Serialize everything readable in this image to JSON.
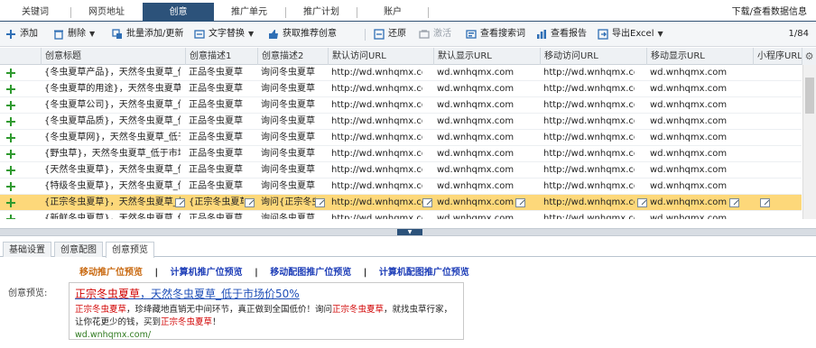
{
  "tabs": [
    {
      "label": "关键词",
      "active": false
    },
    {
      "label": "网页地址",
      "active": false
    },
    {
      "label": "创意",
      "active": true
    },
    {
      "label": "推广单元",
      "active": false
    },
    {
      "label": "推广计划",
      "active": false
    },
    {
      "label": "账户",
      "active": false
    }
  ],
  "tab_right": "下载/查看数据信息",
  "toolbar": {
    "add": "添加",
    "delete": "删除",
    "batch": "批量添加/更新",
    "replace": "文字替换",
    "recommend": "获取推荐创意",
    "restore": "还原",
    "activate": "激活",
    "view_keywords": "查看搜索词",
    "view_report": "查看报告",
    "export": "导出Excel",
    "pager": "1/84"
  },
  "grid": {
    "headers": [
      "创意标题",
      "创意描述1",
      "创意描述2",
      "默认访问URL",
      "默认显示URL",
      "移动访问URL",
      "移动显示URL",
      "小程序URL"
    ],
    "rows": [
      {
        "title": "{冬虫夏草产品}，天然冬虫夏草_低...",
        "d1": "正品冬虫夏草，...",
        "d2": "询问冬虫夏草...",
        "u1": "http://wd.wnhqmx.com/",
        "u2": "wd.wnhqmx.com/",
        "u3": "http://wd.wnhqmx.com/",
        "u4": "wd.wnhqmx.com/",
        "u5": "",
        "selected": false
      },
      {
        "title": "{冬虫夏草的用途}，天然冬虫夏草_低...",
        "d1": "正品冬虫夏草，...",
        "d2": "询问冬虫夏草...",
        "u1": "http://wd.wnhqmx.com/",
        "u2": "wd.wnhqmx.com/",
        "u3": "http://wd.wnhqmx.com/",
        "u4": "wd.wnhqmx.com/",
        "u5": "",
        "selected": false
      },
      {
        "title": "{冬虫夏草公司}，天然冬虫夏草_低...",
        "d1": "正品冬虫夏草，...",
        "d2": "询问冬虫夏草...",
        "u1": "http://wd.wnhqmx.com/",
        "u2": "wd.wnhqmx.com/",
        "u3": "http://wd.wnhqmx.com/",
        "u4": "wd.wnhqmx.com/",
        "u5": "",
        "selected": false
      },
      {
        "title": "{冬虫夏草品质}，天然冬虫夏草_低...",
        "d1": "正品冬虫夏草，...",
        "d2": "询问冬虫夏草...",
        "u1": "http://wd.wnhqmx.com/",
        "u2": "wd.wnhqmx.com/",
        "u3": "http://wd.wnhqmx.com/",
        "u4": "wd.wnhqmx.com/",
        "u5": "",
        "selected": false
      },
      {
        "title": "{冬虫夏草网}，天然冬虫夏草_低于...",
        "d1": "正品冬虫夏草，...",
        "d2": "询问冬虫夏草...",
        "u1": "http://wd.wnhqmx.com/",
        "u2": "wd.wnhqmx.com/",
        "u3": "http://wd.wnhqmx.com/",
        "u4": "wd.wnhqmx.com/",
        "u5": "",
        "selected": false
      },
      {
        "title": "{野虫草}，天然冬虫夏草_低于市场...",
        "d1": "正品冬虫夏草，...",
        "d2": "询问冬虫夏草...",
        "u1": "http://wd.wnhqmx.com/",
        "u2": "wd.wnhqmx.com/",
        "u3": "http://wd.wnhqmx.com/",
        "u4": "wd.wnhqmx.com/",
        "u5": "",
        "selected": false
      },
      {
        "title": "{天然冬虫夏草}，天然冬虫夏草_低...",
        "d1": "正品冬虫夏草，...",
        "d2": "询问冬虫夏草...",
        "u1": "http://wd.wnhqmx.com/",
        "u2": "wd.wnhqmx.com/",
        "u3": "http://wd.wnhqmx.com/",
        "u4": "wd.wnhqmx.com/",
        "u5": "",
        "selected": false
      },
      {
        "title": "{特级冬虫夏草}，天然冬虫夏草_低...",
        "d1": "正品冬虫夏草，...",
        "d2": "询问冬虫夏草...",
        "u1": "http://wd.wnhqmx.com/",
        "u2": "wd.wnhqmx.com/",
        "u3": "http://wd.wnhqmx.com/",
        "u4": "wd.wnhqmx.com/",
        "u5": "",
        "selected": false
      },
      {
        "title": "{正宗冬虫夏草}，天然冬虫夏草_低...",
        "d1": "{正宗冬虫夏草...",
        "d2": "询问{正宗冬虫...",
        "u1": "http://wd.wnhqmx.com/",
        "u2": "wd.wnhqmx.com/",
        "u3": "http://wd.wnhqmx.com/",
        "u4": "wd.wnhqmx.com/",
        "u5": "",
        "selected": true
      },
      {
        "title": "{新鲜冬虫夏草}，天然冬虫夏草_低...",
        "d1": "正品冬虫夏草，...",
        "d2": "询问冬虫夏草...",
        "u1": "http://wd.wnhqmx.com/",
        "u2": "wd.wnhqmx.com/",
        "u3": "http://wd.wnhqmx.com/",
        "u4": "wd.wnhqmx.com/",
        "u5": "",
        "selected": false
      }
    ]
  },
  "bottom_tabs": [
    {
      "label": "基础设置",
      "active": false
    },
    {
      "label": "创意配图",
      "active": false
    },
    {
      "label": "创意预览",
      "active": true
    }
  ],
  "preview": {
    "links": [
      "移动推广位预览",
      "计算机推广位预览",
      "移动配图推广位预览",
      "计算机配图推广位预览"
    ],
    "sep": "|",
    "label": "创意预览:",
    "title_red": "正宗冬虫夏草",
    "title_rest": "，天然冬虫夏草_低于市场价50%",
    "desc_1_red": "正宗冬虫夏草",
    "desc_1": "，珍绛藏地直销无中间环节，真正做到全国低价！询问",
    "desc_2_red": "正宗冬虫夏草",
    "desc_2": "，就找虫草行家，让你花更少的钱，买到",
    "desc_3_red": "正宗冬虫夏草",
    "desc_3": "！",
    "url": "wd.wnhqmx.com/"
  },
  "colors": {
    "accent": "#2c527a",
    "selected_row": "#fdd87a",
    "red": "#d10000",
    "link_blue": "#1f4fb8",
    "url_green": "#2f7a1f"
  }
}
